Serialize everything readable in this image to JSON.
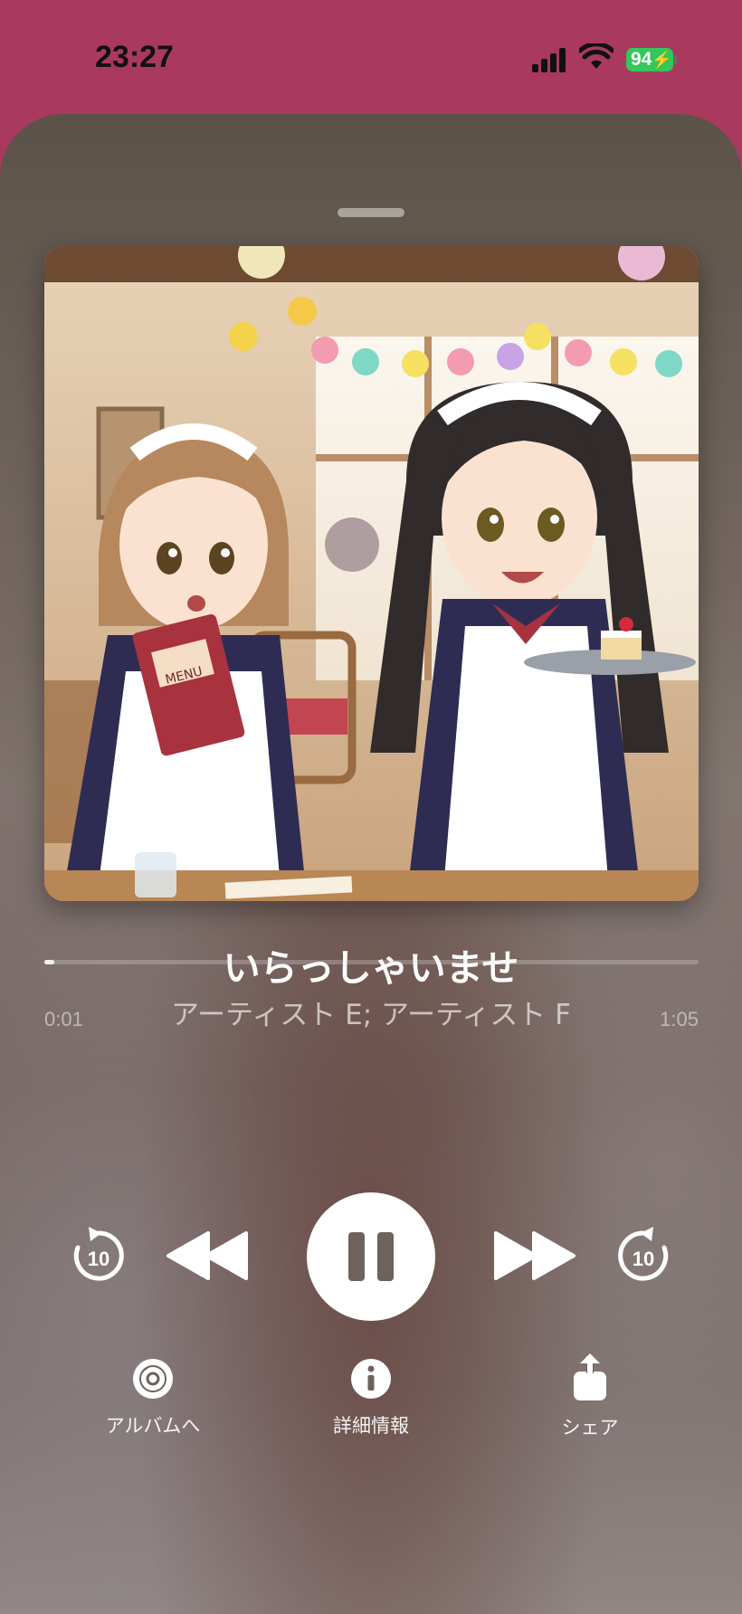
{
  "status_bar": {
    "time": "23:27",
    "battery": "94"
  },
  "now_playing": {
    "title": "いらっしゃいませ",
    "artist": "アーティスト E; アーティスト F",
    "artwork_icon": "album-artwork-maid-cafe",
    "progress": 0.015,
    "elapsed": "0:01",
    "duration": "1:05"
  },
  "controls": {
    "skip_back_seconds": "10",
    "skip_forward_seconds": "10"
  },
  "actions": [
    {
      "label": "アルバムへ",
      "icon": "album-disc-icon"
    },
    {
      "label": "詳細情報",
      "icon": "info-icon"
    },
    {
      "label": "シェア",
      "icon": "share-icon"
    }
  ],
  "colors": {
    "header_bg": "#a9395e",
    "battery": "#34c759"
  }
}
